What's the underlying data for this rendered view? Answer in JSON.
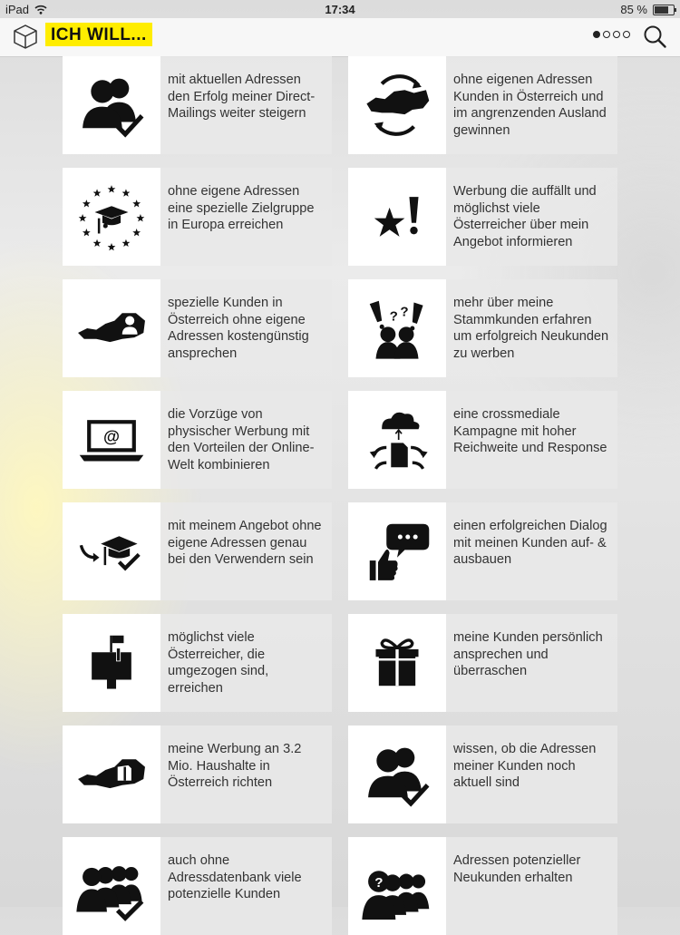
{
  "status": {
    "device": "iPad",
    "time": "17:34",
    "battery": "85 %",
    "battery_level": 0.85
  },
  "nav": {
    "title": "ICH WILL...",
    "page_indicator": {
      "count": 4,
      "active": 1
    }
  },
  "colors": {
    "brand_yellow": "#ffed00",
    "icon": "#111111"
  },
  "tiles": [
    {
      "icon": "people-check-icon",
      "text": "mit aktuellen Adressen den Erfolg meiner Direct-Mailings weiter steigern"
    },
    {
      "icon": "austria-arrows-icon",
      "text": "ohne eigenen Adressen Kunden in Österreich und im angrenzenden Ausland gewinnen"
    },
    {
      "icon": "eu-graduate-icon",
      "text": "ohne eigene Adressen eine spezielle Zielgruppe in Europa erreichen"
    },
    {
      "icon": "star-exclamation-icon",
      "text": "Werbung die auffällt und möglichst viele Österreicher über mein Angebot informieren"
    },
    {
      "icon": "austria-person-icon",
      "text": "spezielle Kunden in Österreich ohne eigene Adressen kostengünstig ansprechen"
    },
    {
      "icon": "people-question-icon",
      "text": "mehr über meine Stammkunden erfahren um erfolgreich Neukunden zu werben"
    },
    {
      "icon": "laptop-email-icon",
      "text": "die Vorzüge von physischer Werbung mit den Vorteilen der Online-Welt kombinieren"
    },
    {
      "icon": "cloud-distribute-icon",
      "text": "eine crossmediale Kampagne mit hoher Reichweite und Response"
    },
    {
      "icon": "arrow-graduate-check-icon",
      "text": "mit meinem Angebot ohne eigene Adressen genau bei den Verwendern sein"
    },
    {
      "icon": "thumb-speech-icon",
      "text": "einen erfolgreichen Dialog mit meinen Kunden auf- & ausbauen"
    },
    {
      "icon": "mailbox-icon",
      "text": "möglichst viele Österreicher, die umgezogen sind, erreichen"
    },
    {
      "icon": "gift-icon",
      "text": "meine Kunden persönlich ansprechen und überraschen"
    },
    {
      "icon": "austria-house-icon",
      "text": "meine Werbung an 3.2 Mio. Haushalte in Österreich richten"
    },
    {
      "icon": "people-check-icon",
      "text": "wissen, ob die Adressen meiner Kunden noch aktuell sind"
    },
    {
      "icon": "crowd-check-icon",
      "text": "auch ohne Adressdatenbank viele potenzielle Kunden"
    },
    {
      "icon": "crowd-question-icon",
      "text": "Adressen potenzieller Neukunden erhalten"
    }
  ]
}
